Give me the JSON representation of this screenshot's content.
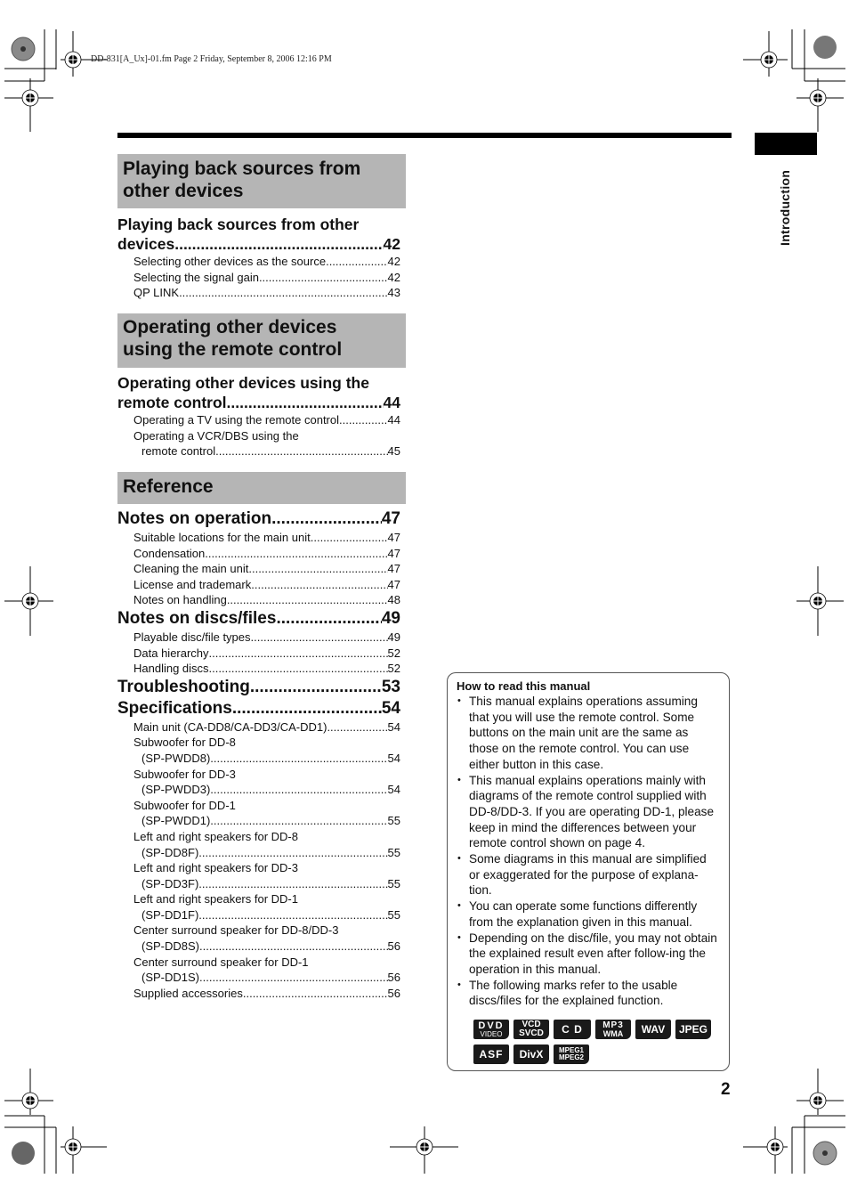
{
  "header": {
    "file_info": "DD-831[A_Ux]-01.fm  Page 2  Friday, September 8, 2006  12:16 PM"
  },
  "side_tab": {
    "label": "Introduction"
  },
  "sections": [
    {
      "title_lines": [
        "Playing back sources from",
        "other devices"
      ],
      "entries": {
        "main_lines": [
          "Playing back sources from other",
          "devices"
        ],
        "main_page": "42",
        "subs": [
          {
            "label": "Selecting other devices as the source",
            "page": "42"
          },
          {
            "label": "Selecting the signal gain",
            "page": "42"
          },
          {
            "label": "QP LINK",
            "page": "43"
          }
        ]
      }
    },
    {
      "title_lines": [
        "Operating other devices",
        "using the remote control"
      ],
      "entries": {
        "main_lines": [
          "Operating other devices using the",
          "remote control"
        ],
        "main_page": "44",
        "subs": [
          {
            "label": "Operating a TV using the remote control",
            "page": "44"
          },
          {
            "label": "Operating a VCR/DBS using the",
            "label2": "remote control",
            "page": "45"
          }
        ]
      }
    },
    {
      "title_lines": [
        "Reference"
      ],
      "groups": [
        {
          "main": "Notes on operation",
          "page": "47",
          "subs": [
            {
              "label": "Suitable locations for the main unit",
              "page": "47"
            },
            {
              "label": "Condensation",
              "page": "47"
            },
            {
              "label": "Cleaning the main unit",
              "page": "47"
            },
            {
              "label": "License and trademark",
              "page": "47"
            },
            {
              "label": "Notes on handling",
              "page": "48"
            }
          ]
        },
        {
          "main": "Notes on discs/files",
          "page": "49",
          "subs": [
            {
              "label": "Playable disc/file types",
              "page": "49"
            },
            {
              "label": "Data hierarchy",
              "page": "52"
            },
            {
              "label": "Handling discs",
              "page": "52"
            }
          ]
        },
        {
          "main": "Troubleshooting ",
          "page": "53",
          "subs": []
        },
        {
          "main": "Specifications ",
          "page": "54",
          "subs": [
            {
              "label": "Main unit (CA-DD8/CA-DD3/CA-DD1)",
              "page": "54"
            },
            {
              "label": "Subwoofer for DD-8",
              "label2": "(SP-PWDD8) ",
              "page": "54"
            },
            {
              "label": "Subwoofer for DD-3",
              "label2": "(SP-PWDD3) ",
              "page": "54"
            },
            {
              "label": "Subwoofer for DD-1",
              "label2": "(SP-PWDD1) ",
              "page": "55"
            },
            {
              "label": "Left and right speakers for DD-8",
              "label2": "(SP-DD8F)",
              "page": "55"
            },
            {
              "label": "Left and right speakers for DD-3",
              "label2": "(SP-DD3F)",
              "page": "55"
            },
            {
              "label": "Left and right speakers for DD-1",
              "label2": "(SP-DD1F)",
              "page": "55"
            },
            {
              "label": "Center surround speaker for DD-8/DD-3",
              "label2": "(SP-DD8S)",
              "page": "56"
            },
            {
              "label": "Center surround speaker for DD-1",
              "label2": "(SP-DD1S)",
              "page": "56"
            },
            {
              "label": "Supplied accessories ",
              "page": "56"
            }
          ]
        }
      ]
    }
  ],
  "note_box": {
    "title": "How to read this manual",
    "bullets": [
      "This manual explains operations assuming that you will use the remote control. Some buttons on the main unit are the same as those on the remote control. You can use either button in this case.",
      "This manual explains operations mainly with diagrams of the remote control supplied with DD-8/DD-3. If you are operating DD-1, please keep in mind the differences between your remote control shown on page 4.",
      "Some diagrams in this manual are simplified or exaggerated for the purpose of explana-tion.",
      "You can operate some functions differently from the explanation given in this manual.",
      "Depending on the disc/file, you may not obtain the explained result even after follow-ing the operation in this manual.",
      "The following marks refer to the usable discs/files for the explained function."
    ],
    "marks": [
      {
        "line1": "DVD",
        "line2": "VIDEO"
      },
      {
        "line1": "VCD",
        "line2": "SVCD"
      },
      {
        "line1": "C D"
      },
      {
        "line1": "MP3",
        "line2": "WMA"
      },
      {
        "line1": "WAV"
      },
      {
        "line1": "JPEG"
      },
      {
        "line1": "ASF"
      },
      {
        "line1": "DivX"
      },
      {
        "line1": "MPEG1",
        "line2": "MPEG2"
      }
    ]
  },
  "page_number": "2"
}
